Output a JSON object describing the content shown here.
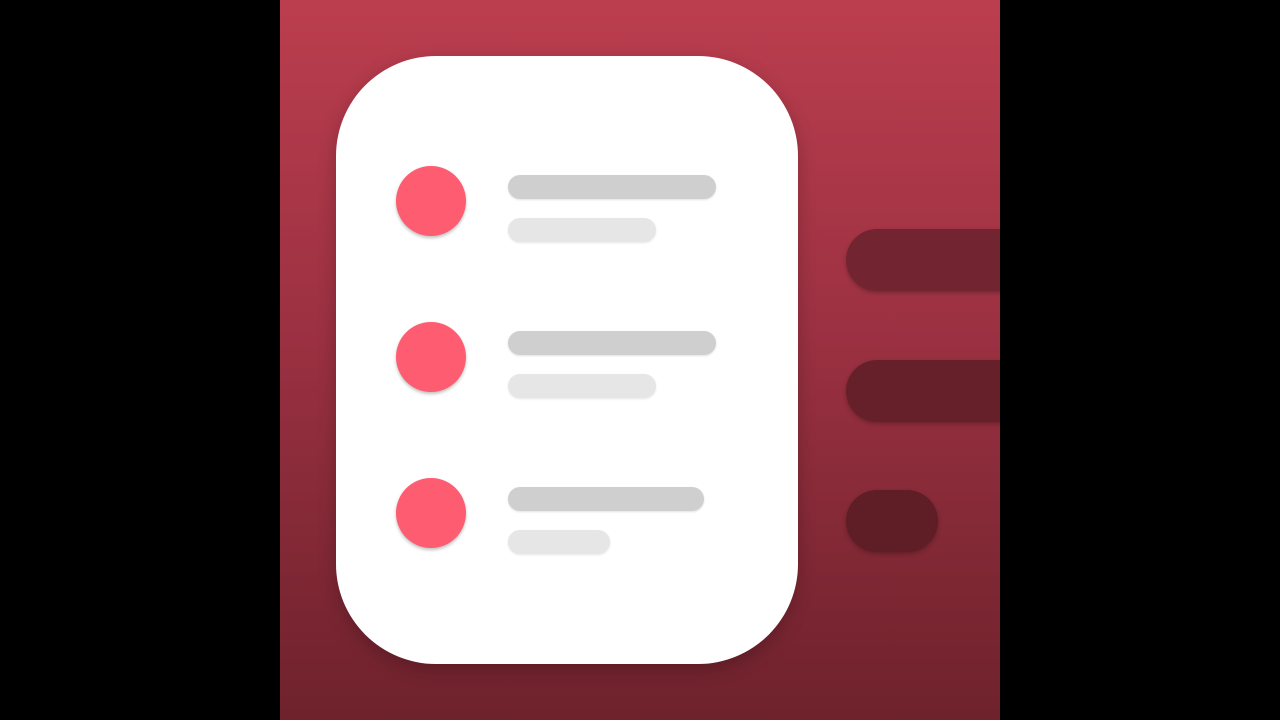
{
  "app_icon": {
    "colors": {
      "background_top": "#bb3e4e",
      "background_bottom": "#6e222c",
      "card": "#ffffff",
      "dot": "#fd5c71",
      "title_line": "#cfcfcf",
      "subtitle_line": "#e6e6e6",
      "side_tab": "#66202a"
    },
    "list_rows": [
      {
        "icon": "red-dot",
        "has_title_line": true,
        "has_subtitle_line": true
      },
      {
        "icon": "red-dot",
        "has_title_line": true,
        "has_subtitle_line": true
      },
      {
        "icon": "red-dot",
        "has_title_line": true,
        "has_subtitle_line": true
      }
    ],
    "side_tabs_count": 3
  }
}
